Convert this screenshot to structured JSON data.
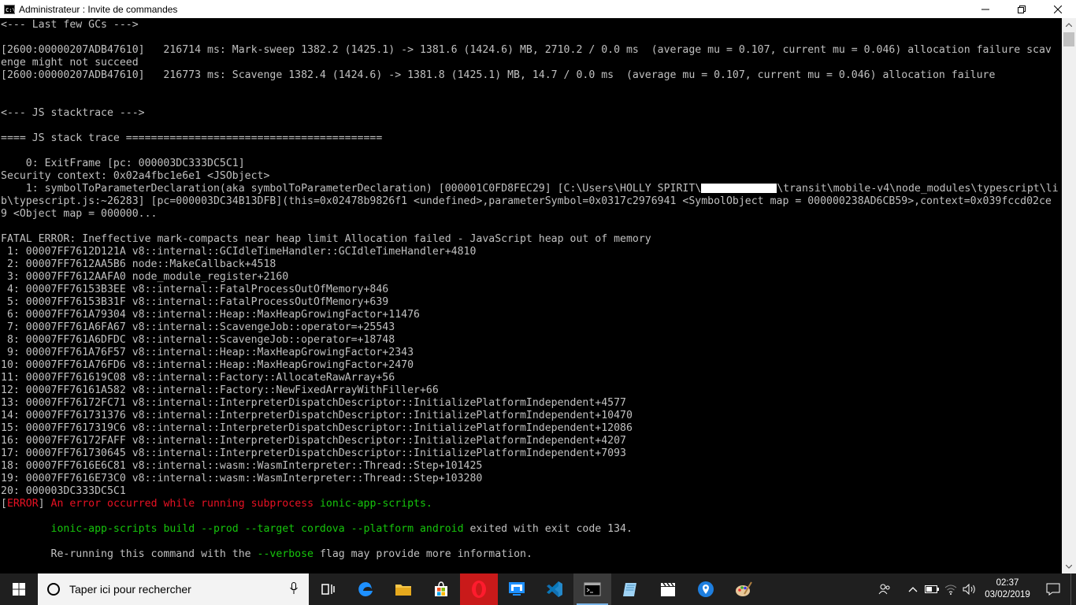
{
  "window": {
    "title": "Administrateur : Invite de commandes",
    "icon": "cmd-icon",
    "icon_text": "C:\\"
  },
  "console": {
    "lines": [
      [
        {
          "t": "<--- Last few GCs --->"
        }
      ],
      [
        {
          "t": ""
        }
      ],
      [
        {
          "t": "[2600:00000207ADB47610]   216714 ms: Mark-sweep 1382.2 (1425.1) -> 1381.6 (1424.6) MB, 2710.2 / 0.0 ms  (average mu = 0.107, current mu = 0.046) allocation failure scav"
        }
      ],
      [
        {
          "t": "enge might not succeed"
        }
      ],
      [
        {
          "t": "[2600:00000207ADB47610]   216773 ms: Scavenge 1382.4 (1424.6) -> 1381.8 (1425.1) MB, 14.7 / 0.0 ms  (average mu = 0.107, current mu = 0.046) allocation failure"
        }
      ],
      [
        {
          "t": ""
        }
      ],
      [
        {
          "t": ""
        }
      ],
      [
        {
          "t": "<--- JS stacktrace --->"
        }
      ],
      [
        {
          "t": ""
        }
      ],
      [
        {
          "t": "==== JS stack trace ========================================="
        }
      ],
      [
        {
          "t": ""
        }
      ],
      [
        {
          "t": "    0: ExitFrame [pc: 000003DC333DC5C1]"
        }
      ],
      [
        {
          "t": "Security context: 0x02a4fbc1e6e1 <JSObject>"
        }
      ],
      [
        {
          "t": "    1: symbolToParameterDeclaration(aka symbolToParameterDeclaration) [000001C0FD8FEC29] [C:\\Users\\HOLLY SPIRIT\\"
        },
        {
          "redact": true
        },
        {
          "t": "\\transit\\mobile-v4\\node_modules\\typescript\\li"
        }
      ],
      [
        {
          "t": "b\\typescript.js:~26283] [pc=000003DC34B13DFB](this=0x02478b9826f1 <undefined>,parameterSymbol=0x0317c2976941 <SymbolObject map = 000000238AD6CB59>,context=0x039fccd02ce"
        }
      ],
      [
        {
          "t": "9 <Object map = 000000..."
        }
      ],
      [
        {
          "t": ""
        }
      ],
      [
        {
          "t": "FATAL ERROR: Ineffective mark-compacts near heap limit Allocation failed - JavaScript heap out of memory"
        }
      ],
      [
        {
          "t": " 1: 00007FF7612D121A v8::internal::GCIdleTimeHandler::GCIdleTimeHandler+4810"
        }
      ],
      [
        {
          "t": " 2: 00007FF7612AA5B6 node::MakeCallback+4518"
        }
      ],
      [
        {
          "t": " 3: 00007FF7612AAFA0 node_module_register+2160"
        }
      ],
      [
        {
          "t": " 4: 00007FF76153B3EE v8::internal::FatalProcessOutOfMemory+846"
        }
      ],
      [
        {
          "t": " 5: 00007FF76153B31F v8::internal::FatalProcessOutOfMemory+639"
        }
      ],
      [
        {
          "t": " 6: 00007FF761A79304 v8::internal::Heap::MaxHeapGrowingFactor+11476"
        }
      ],
      [
        {
          "t": " 7: 00007FF761A6FA67 v8::internal::ScavengeJob::operator=+25543"
        }
      ],
      [
        {
          "t": " 8: 00007FF761A6DFDC v8::internal::ScavengeJob::operator=+18748"
        }
      ],
      [
        {
          "t": " 9: 00007FF761A76F57 v8::internal::Heap::MaxHeapGrowingFactor+2343"
        }
      ],
      [
        {
          "t": "10: 00007FF761A76FD6 v8::internal::Heap::MaxHeapGrowingFactor+2470"
        }
      ],
      [
        {
          "t": "11: 00007FF761619C08 v8::internal::Factory::AllocateRawArray+56"
        }
      ],
      [
        {
          "t": "12: 00007FF76161A582 v8::internal::Factory::NewFixedArrayWithFiller+66"
        }
      ],
      [
        {
          "t": "13: 00007FF76172FC71 v8::internal::InterpreterDispatchDescriptor::InitializePlatformIndependent+4577"
        }
      ],
      [
        {
          "t": "14: 00007FF761731376 v8::internal::InterpreterDispatchDescriptor::InitializePlatformIndependent+10470"
        }
      ],
      [
        {
          "t": "15: 00007FF7617319C6 v8::internal::InterpreterDispatchDescriptor::InitializePlatformIndependent+12086"
        }
      ],
      [
        {
          "t": "16: 00007FF76172FAFF v8::internal::InterpreterDispatchDescriptor::InitializePlatformIndependent+4207"
        }
      ],
      [
        {
          "t": "17: 00007FF761730645 v8::internal::InterpreterDispatchDescriptor::InitializePlatformIndependent+7093"
        }
      ],
      [
        {
          "t": "18: 00007FF7616E6C81 v8::internal::wasm::WasmInterpreter::Thread::Step+101425"
        }
      ],
      [
        {
          "t": "19: 00007FF7616E73C0 v8::internal::wasm::WasmInterpreter::Thread::Step+103280"
        }
      ],
      [
        {
          "t": "20: 000003DC333DC5C1"
        }
      ],
      [
        {
          "t": "["
        },
        {
          "t": "ERROR",
          "c": "red"
        },
        {
          "t": "] "
        },
        {
          "t": "An error occurred while running subprocess ",
          "c": "red"
        },
        {
          "t": "ionic-app-scripts.",
          "c": "green"
        }
      ],
      [
        {
          "t": ""
        }
      ],
      [
        {
          "t": "        "
        },
        {
          "t": "ionic-app-scripts build --prod --target cordova --platform android",
          "c": "green"
        },
        {
          "t": " exited with exit code 134."
        }
      ],
      [
        {
          "t": ""
        }
      ],
      [
        {
          "t": "        Re-running this command with the "
        },
        {
          "t": "--verbose",
          "c": "green"
        },
        {
          "t": " flag may provide more information."
        }
      ]
    ]
  },
  "taskbar": {
    "search_placeholder": "Taper ici pour rechercher",
    "icons": [
      "task-view-icon",
      "edge-icon",
      "file-explorer-icon",
      "store-icon",
      "opera-icon",
      "remote-desktop-icon",
      "visual-studio-code-icon",
      "command-prompt-icon",
      "notepad-icon",
      "clapperboard-icon",
      "maps-icon",
      "paint-icon"
    ],
    "active_icon": "command-prompt-icon",
    "clock": {
      "time": "02:37",
      "date": "03/02/2019"
    }
  },
  "colors": {
    "red": "#e81123",
    "green": "#16c60c",
    "text": "#c0c0c0",
    "taskbar": "#1f1f1f"
  }
}
